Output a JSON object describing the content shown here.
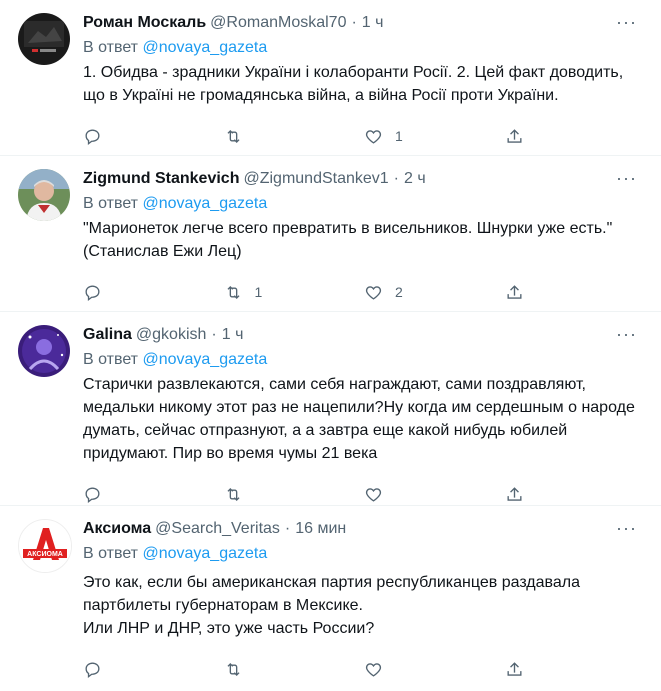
{
  "reply_prefix": "В ответ",
  "tweets": [
    {
      "name": "Роман Москаль",
      "handle": "@RomanMoskal70",
      "time": "1 ч",
      "reply_to": "@novaya_gazeta",
      "text": "1. Обидва - зрадники України і колаборанти Росії. 2. Цей факт доводить, що в Україні не громадянська війна, а війна Росії проти України.",
      "retweets": "",
      "likes": "1"
    },
    {
      "name": "Zigmund Stankevich",
      "handle": "@ZigmundStankev1",
      "time": "2 ч",
      "reply_to": "@novaya_gazeta",
      "text": "\"Марионеток легче всего превратить в висельников. Шнурки уже есть.\" (Станислав Ежи Лец)",
      "retweets": "1",
      "likes": "2"
    },
    {
      "name": "Galina",
      "handle": "@gkokish",
      "time": "1 ч",
      "reply_to": "@novaya_gazeta",
      "text": "Старички развлекаются, сами себя награждают, сами поздравляют, медальки никому этот раз не нацепили?Ну когда им сердешным о народе думать, сейчас отпразнуют, а а завтра еще какой нибудь юбилей придумают. Пир во время чумы 21 века",
      "retweets": "",
      "likes": ""
    },
    {
      "name": "Аксиома",
      "handle": "@Search_Veritas",
      "time": "16 мин",
      "reply_to": "@novaya_gazeta",
      "text": "Это как, если бы американская партия республиканцев раздавала партбилеты губернаторам в Мексике.\nИли ЛНР и ДНР, это уже часть России?",
      "retweets": "",
      "likes": ""
    }
  ],
  "avatar_logo_text": "АКСИОМА"
}
